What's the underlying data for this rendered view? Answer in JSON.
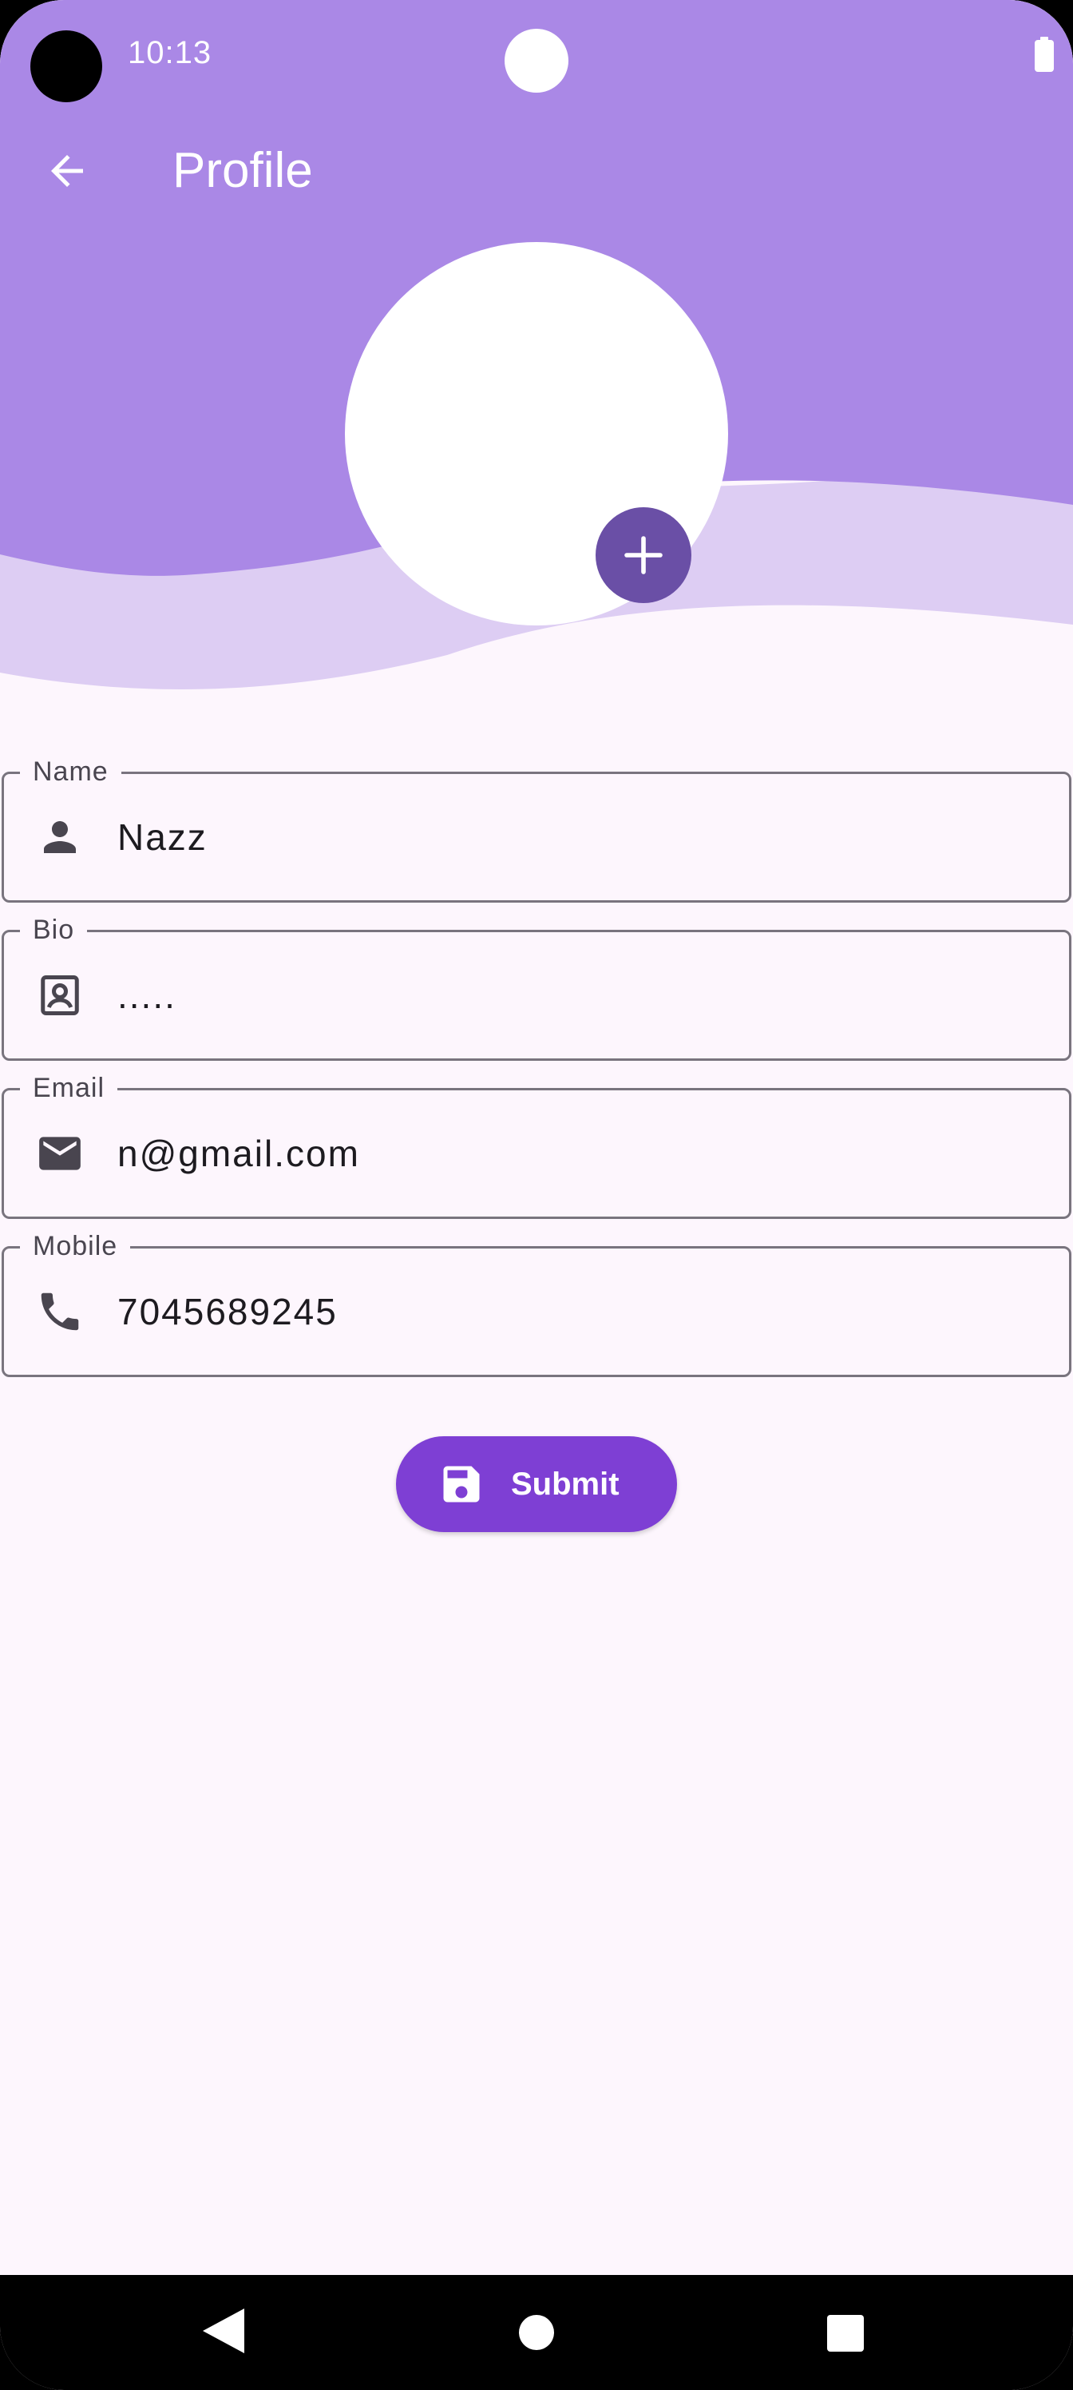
{
  "status_bar": {
    "time": "10:13",
    "battery_icon": "battery-full-icon"
  },
  "app_bar": {
    "title": "Profile",
    "back_icon": "arrow-back-icon"
  },
  "profile_photo": {
    "add_icon": "plus-icon"
  },
  "form": {
    "fields": [
      {
        "label": "Name",
        "value": "Nazz",
        "icon": "person-icon"
      },
      {
        "label": "Bio",
        "value": ".....",
        "icon": "contact-card-icon"
      },
      {
        "label": "Email",
        "value": "n@gmail.com",
        "icon": "mail-icon"
      },
      {
        "label": "Mobile",
        "value": "7045689245",
        "icon": "phone-icon"
      }
    ],
    "submit_label": "Submit",
    "submit_icon": "save-icon"
  },
  "nav_bar": {
    "back_icon": "nav-back-icon",
    "home_icon": "nav-home-icon",
    "recents_icon": "nav-recents-icon"
  },
  "colors": {
    "header": "#AA88E6",
    "wave": "#DDCDF3",
    "background": "#FDF6FD",
    "fab": "#6A4FA6",
    "submit": "#7E3FD4",
    "outline": "#79747E"
  }
}
